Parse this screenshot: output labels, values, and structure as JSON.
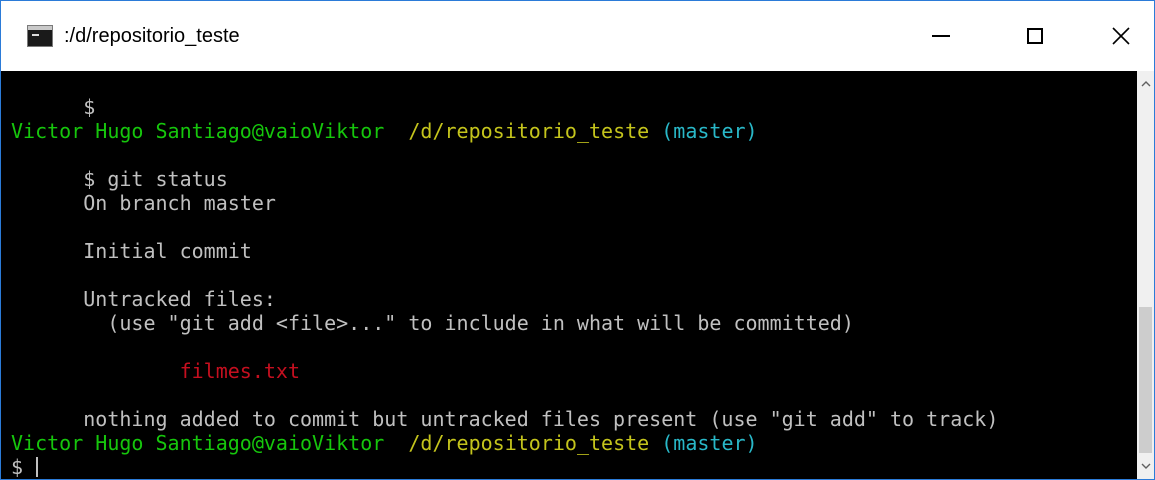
{
  "window": {
    "title": ":/d/repositorio_teste",
    "minimize_icon": "minimize-icon",
    "maximize_icon": "maximize-icon",
    "close_icon": "close-icon",
    "close_glyph": "✕",
    "border_color": "#2b7bd8"
  },
  "terminal": {
    "colors": {
      "background": "#000000",
      "text": "#c0c0c0",
      "user": "#16c60c",
      "path": "#c4c41c",
      "branch": "#29b8c8",
      "untracked": "#c50f1f"
    },
    "line1": {
      "text": "$"
    },
    "prompt1": {
      "user": "Victor Hugo Santiago@vaioViktor",
      "path": "/d/repositorio_teste",
      "branch": "(master)"
    },
    "command": {
      "text": "$ git status"
    },
    "on_branch": {
      "text": "On branch master"
    },
    "initial_commit": {
      "text": "Initial commit"
    },
    "untracked_header": {
      "text": "Untracked files:"
    },
    "untracked_hint": {
      "text": "  (use \"git add <file>...\" to include in what will be committed)"
    },
    "untracked_file": {
      "text": "        filmes.txt"
    },
    "summary": {
      "text": "nothing added to commit but untracked files present (use \"git add\" to track)"
    },
    "prompt2": {
      "user": "Victor Hugo Santiago@vaioViktor",
      "path": "/d/repositorio_teste",
      "branch": "(master)"
    },
    "input_line": {
      "text": "$ "
    }
  },
  "scrollbar": {
    "up_arrow": "chevron-up-icon",
    "down_arrow": "chevron-down-icon"
  }
}
